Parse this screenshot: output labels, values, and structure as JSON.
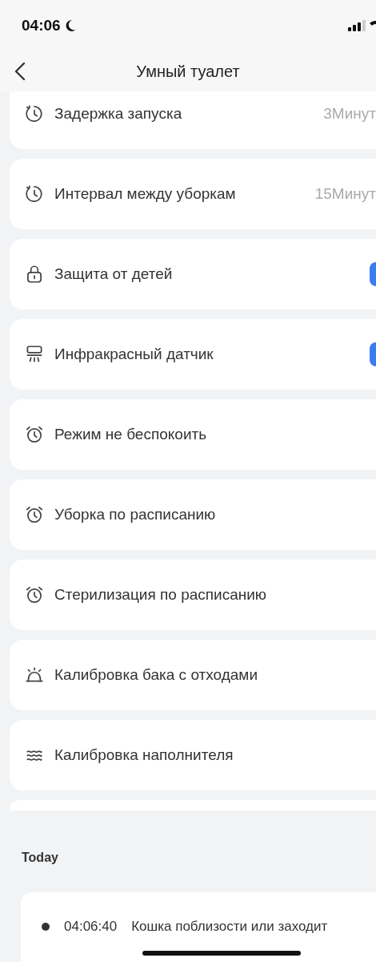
{
  "status_bar": {
    "time": "04:06"
  },
  "header": {
    "title": "Умный туалет"
  },
  "settings": [
    {
      "kind": "value",
      "label": "Задержка запуска",
      "value": "3Минут"
    },
    {
      "kind": "value",
      "label": "Интервал между уборкам",
      "value": "15Минут"
    },
    {
      "kind": "toggle",
      "label": "Защита от детей",
      "on": true
    },
    {
      "kind": "toggle",
      "label": "Инфракрасный датчик",
      "on": true
    },
    {
      "kind": "link",
      "label": "Режим не беспокоить"
    },
    {
      "kind": "link",
      "label": "Уборка по расписанию"
    },
    {
      "kind": "link",
      "label": "Стерилизация по расписанию"
    },
    {
      "kind": "link",
      "label": "Калибровка бака с отходами"
    },
    {
      "kind": "link",
      "label": "Калибровка наполнителя"
    }
  ],
  "history": {
    "heading": "Today",
    "records": [
      {
        "time": "04:06:40",
        "text": "Кошка поблизости или заходит"
      }
    ]
  }
}
